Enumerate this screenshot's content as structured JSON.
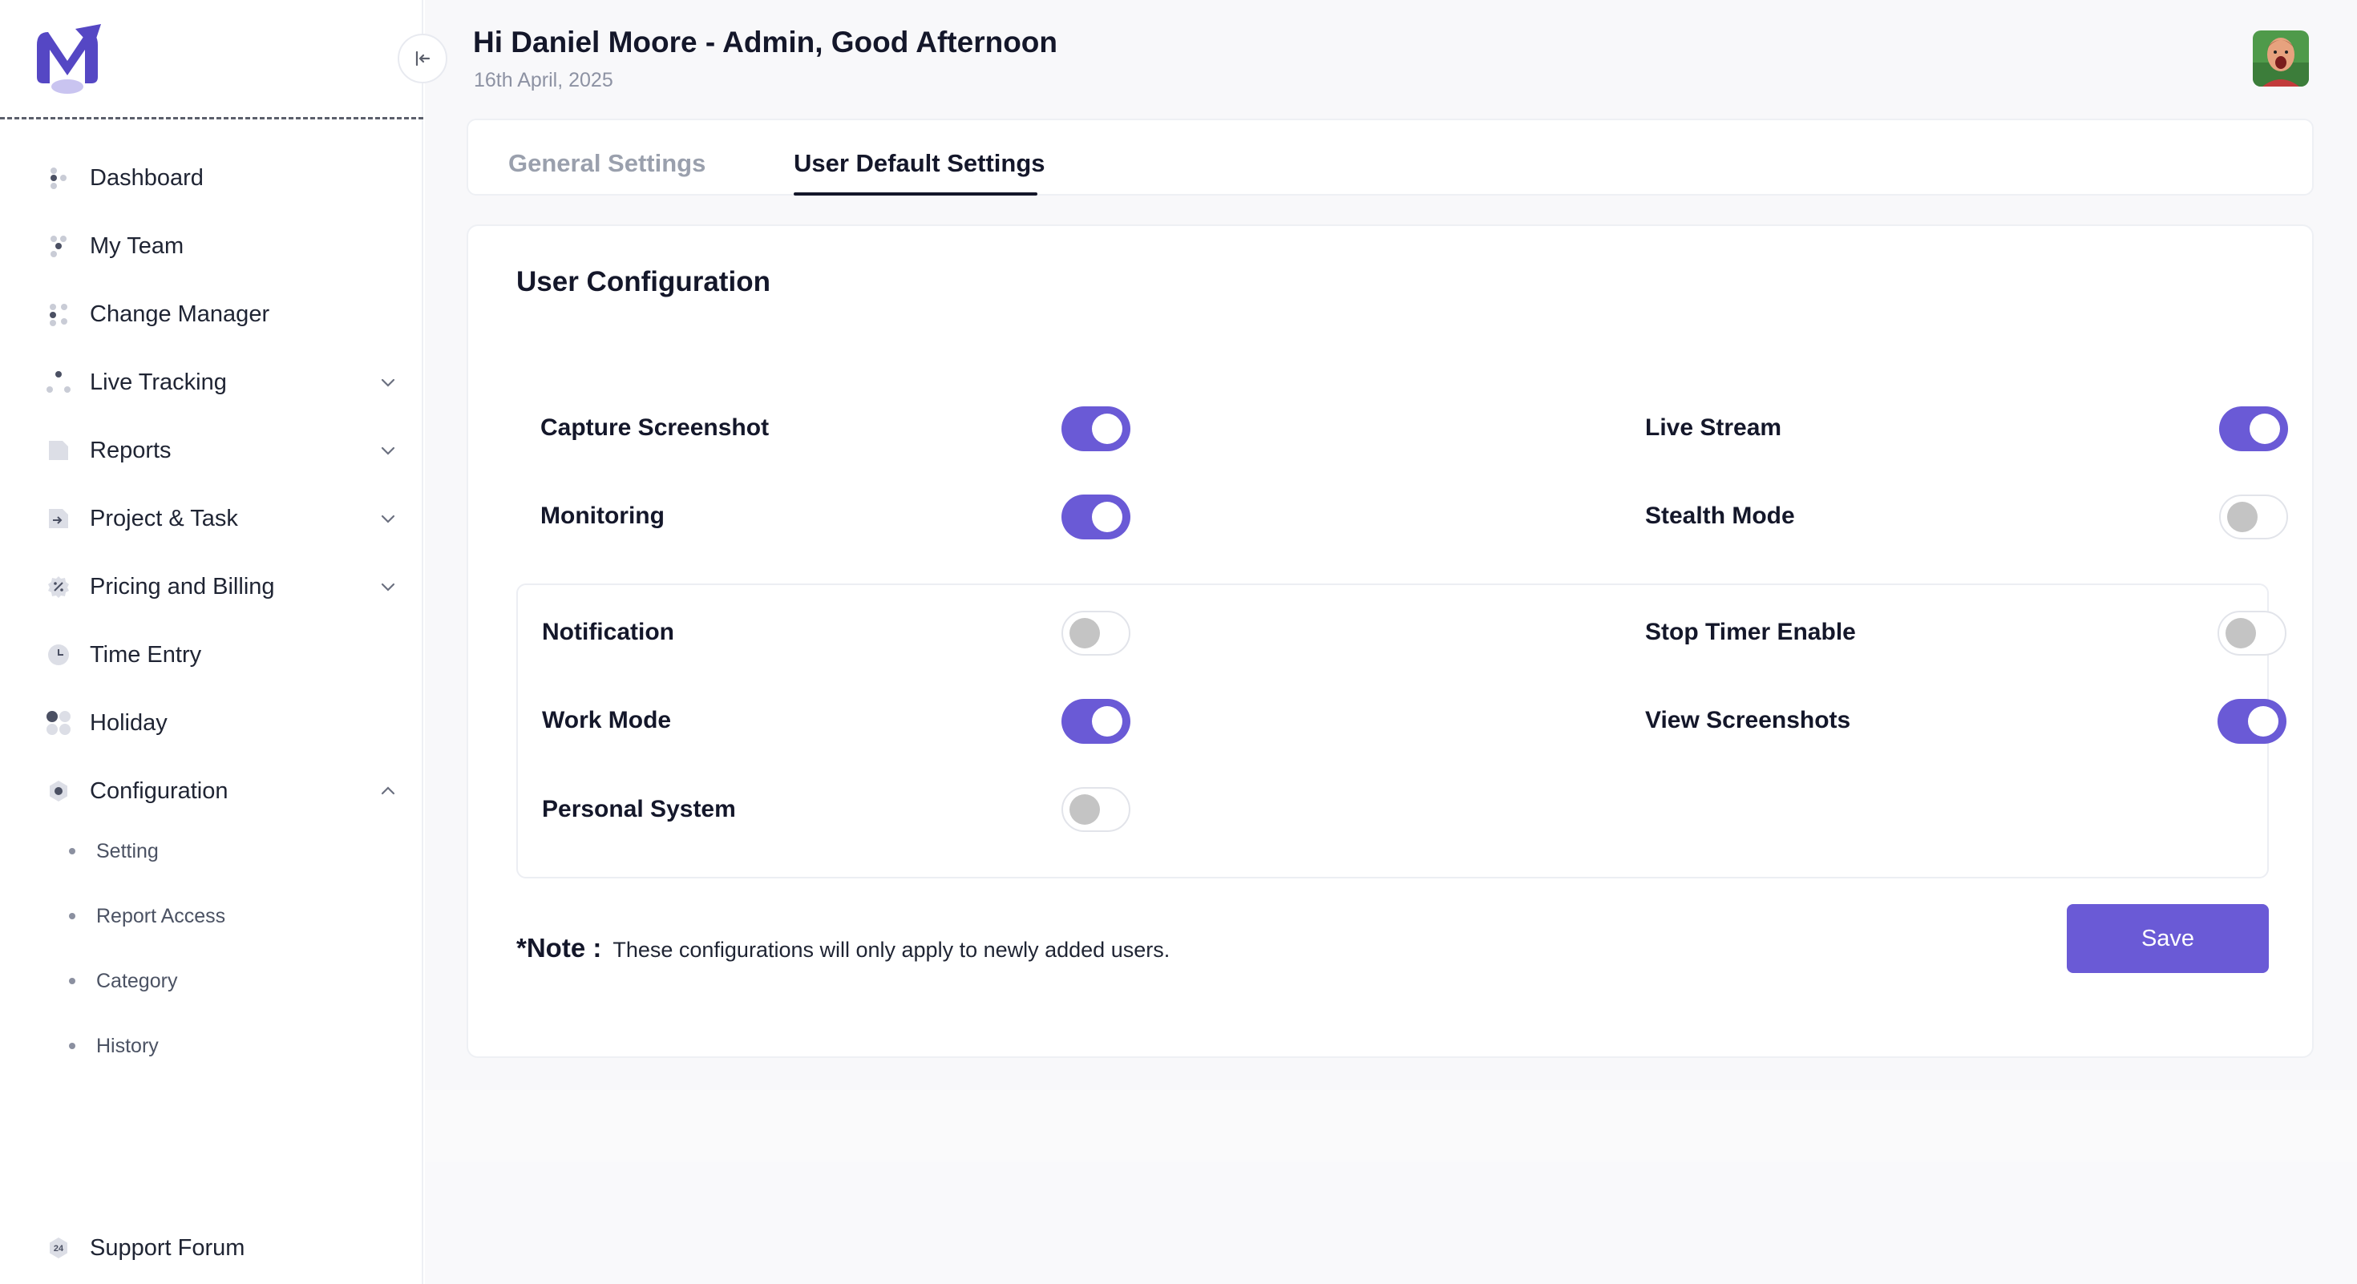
{
  "header": {
    "greeting": "Hi Daniel Moore - Admin, Good Afternoon",
    "date": "16th April, 2025"
  },
  "sidebar": {
    "items": [
      {
        "label": "Dashboard",
        "icon": "dashboard-icon",
        "has_chevron": false
      },
      {
        "label": "My Team",
        "icon": "team-icon",
        "has_chevron": false
      },
      {
        "label": "Change Manager",
        "icon": "change-manager-icon",
        "has_chevron": false
      },
      {
        "label": "Live Tracking",
        "icon": "live-tracking-icon",
        "has_chevron": true
      },
      {
        "label": "Reports",
        "icon": "reports-icon",
        "has_chevron": true
      },
      {
        "label": "Project & Task",
        "icon": "project-task-icon",
        "has_chevron": true
      },
      {
        "label": "Pricing and Billing",
        "icon": "pricing-icon",
        "has_chevron": true
      },
      {
        "label": "Time Entry",
        "icon": "clock-icon",
        "has_chevron": false
      },
      {
        "label": "Holiday",
        "icon": "holiday-icon",
        "has_chevron": false
      },
      {
        "label": "Configuration",
        "icon": "configuration-icon",
        "has_chevron": true,
        "expanded": true
      }
    ],
    "sub_items": [
      {
        "label": "Setting"
      },
      {
        "label": "Report Access"
      },
      {
        "label": "Category"
      },
      {
        "label": "History"
      }
    ],
    "support": {
      "label": "Support Forum",
      "icon": "support-24-icon",
      "icon_text": "24"
    }
  },
  "tabs": [
    {
      "label": "General Settings",
      "active": false
    },
    {
      "label": "User Default Settings",
      "active": true
    }
  ],
  "config": {
    "title": "User Configuration",
    "settings": [
      {
        "label": "Capture Screenshot",
        "enabled": true
      },
      {
        "label": "Live Stream",
        "enabled": true
      },
      {
        "label": "Monitoring",
        "enabled": true
      },
      {
        "label": "Stealth Mode",
        "enabled": false
      },
      {
        "label": "Notification",
        "enabled": false
      },
      {
        "label": "Stop Timer Enable",
        "enabled": false
      },
      {
        "label": "Work Mode",
        "enabled": true
      },
      {
        "label": "View Screenshots",
        "enabled": true
      },
      {
        "label": "Personal System",
        "enabled": false
      }
    ],
    "note_title": "*Note :",
    "note_text": "These configurations will only apply to newly added users.",
    "save_label": "Save"
  },
  "colors": {
    "accent": "#6a5ad6",
    "toggle_off_knob": "#c4c4c4",
    "text_primary": "#14172a",
    "text_muted": "#8d92a3"
  }
}
